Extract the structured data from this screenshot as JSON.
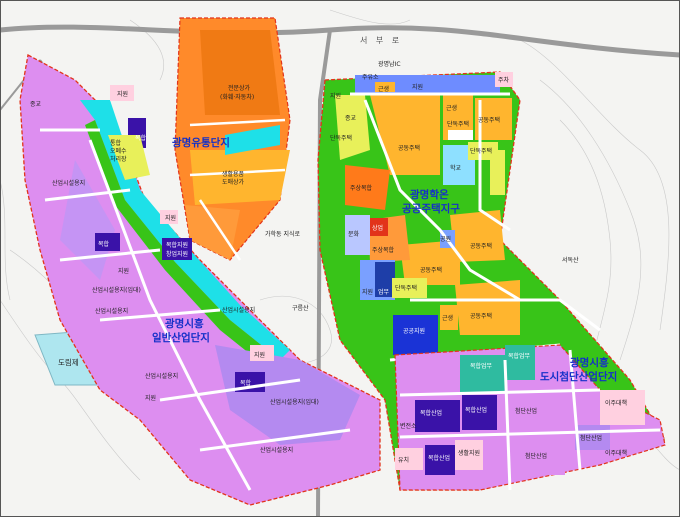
{
  "roads": {
    "seobu_ro": "서 부 로",
    "ic": "광명남IC",
    "jisik_ro": "가학동 지식로"
  },
  "districts": {
    "ilban_line1": "광명시흥",
    "ilban_line2": "일반산업단지",
    "yutong": "광명유통단지",
    "hakon_line1": "광명학온",
    "hakon_line2": "공공주택지구",
    "cheomdan_line1": "광명시흥",
    "cheomdan_line2": "도시첨단산업단지"
  },
  "places": {
    "seodoksan": "서독산",
    "gureumsan": "구름산",
    "dorimje": "도림제"
  },
  "labels": {
    "jiwon": "지원",
    "sanup_sisul": "산업시설용지",
    "sanup_sisul_imdae": "산업시설용지(임대)",
    "bokhap": "복합",
    "jeonmun_sangga_1": "전문상가",
    "jeonmun_sangga_2": "(화훼·자동차)",
    "saenghwal_1": "생활용품",
    "saenghwal_2": "도매상가",
    "tonghap_1": "통합",
    "tonghap_2": "오폐수",
    "tonghap_3": "처리장",
    "gongdong": "공동주택",
    "danduk": "단독주택",
    "jusang": "주상복합",
    "geunsaeng": "근생",
    "hakgyo": "학교",
    "munhwa": "문화",
    "sangeop": "상업",
    "upmu": "업무",
    "gongwon": "공원",
    "jongyo": "종교",
    "juyuso": "주유소",
    "jucha": "주차",
    "yuchi": "유치",
    "byeonjeonso": "변전소",
    "cheomdan": "첨단산업",
    "cheomdan_sanup": "첨단산업",
    "bokhap_upmu": "복합업무",
    "bokhap_sanup": "복합산업",
    "saenghwal_jiwon": "생활지원",
    "ijoo": "이주대책",
    "gongnam": "공공지원",
    "bokhap_jiwon": "복합지원",
    "sangmul": "창업지원"
  },
  "colors": {
    "industrial": "#dd8ef0",
    "industrial_lease": "#b48af0",
    "complex": "#3a12a8",
    "residential": "#ffb52e",
    "commercial": "#ff7a1a",
    "park": "#38c418",
    "water": "#1ee0e8",
    "road": "#ffffff"
  }
}
